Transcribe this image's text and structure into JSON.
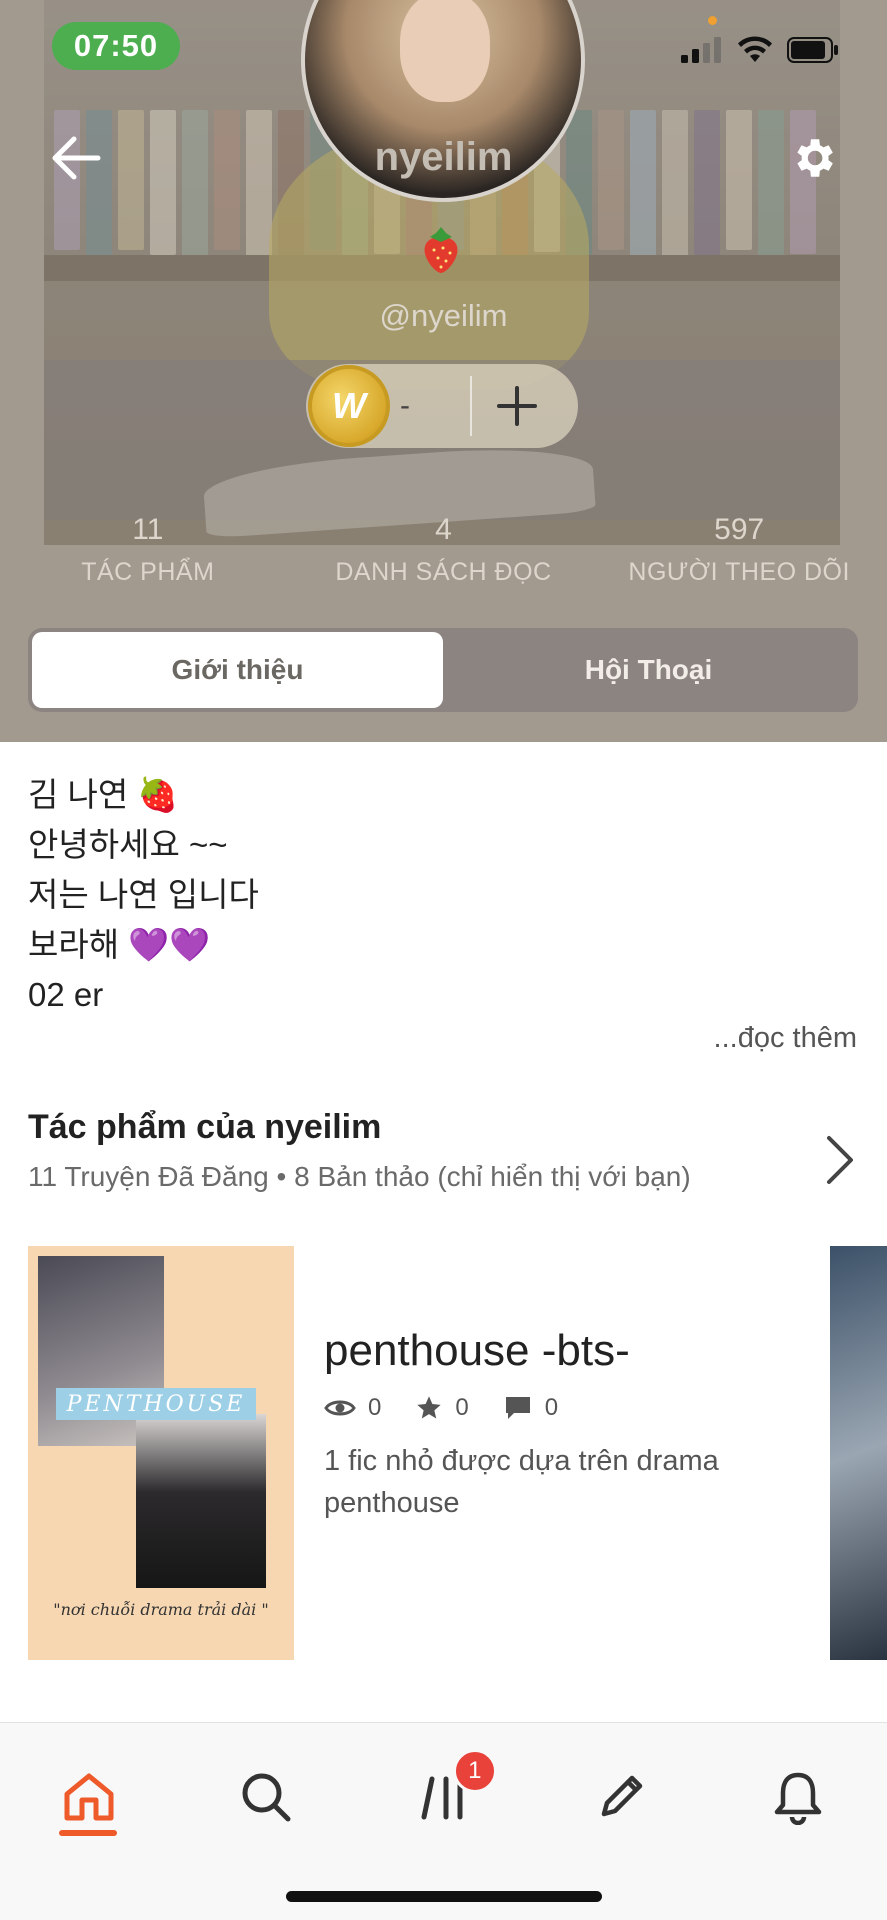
{
  "status_bar": {
    "time": "07:50"
  },
  "profile": {
    "display_name": "nyeilim",
    "handle": "@nyeilim",
    "coin_count": "-"
  },
  "stats": [
    {
      "value": "11",
      "label": "TÁC PHẨM"
    },
    {
      "value": "4",
      "label": "DANH SÁCH ĐỌC"
    },
    {
      "value": "597",
      "label": "NGƯỜI THEO DÕI"
    }
  ],
  "tabs": [
    {
      "label": "Giới thiệu",
      "active": true
    },
    {
      "label": "Hội Thoại",
      "active": false
    }
  ],
  "bio": {
    "lines": [
      "김 나연 🍓",
      "안녕하세요 ~~",
      "저는 나연 입니다",
      "보라해 💜💜",
      "02 er"
    ],
    "read_more": "...đọc thêm"
  },
  "works": {
    "title": "Tác phẩm của nyeilim",
    "subtitle": "11 Truyện Đã Đăng • 8 Bản thảo (chỉ hiển thị với bạn)",
    "items": [
      {
        "title": "penthouse -bts-",
        "reads": "0",
        "votes": "0",
        "comments": "0",
        "description": "1 fic nhỏ được dựa trên drama penthouse",
        "cover_banner": "PENTHOUSE",
        "cover_quote": "\"nơi chuỗi drama trải dài \""
      }
    ]
  },
  "bottom_nav": {
    "items": [
      "home-icon",
      "search-icon",
      "library-icon",
      "write-icon",
      "notifications-icon"
    ],
    "library_badge": "1",
    "accent_color": "#ee5a2a"
  }
}
